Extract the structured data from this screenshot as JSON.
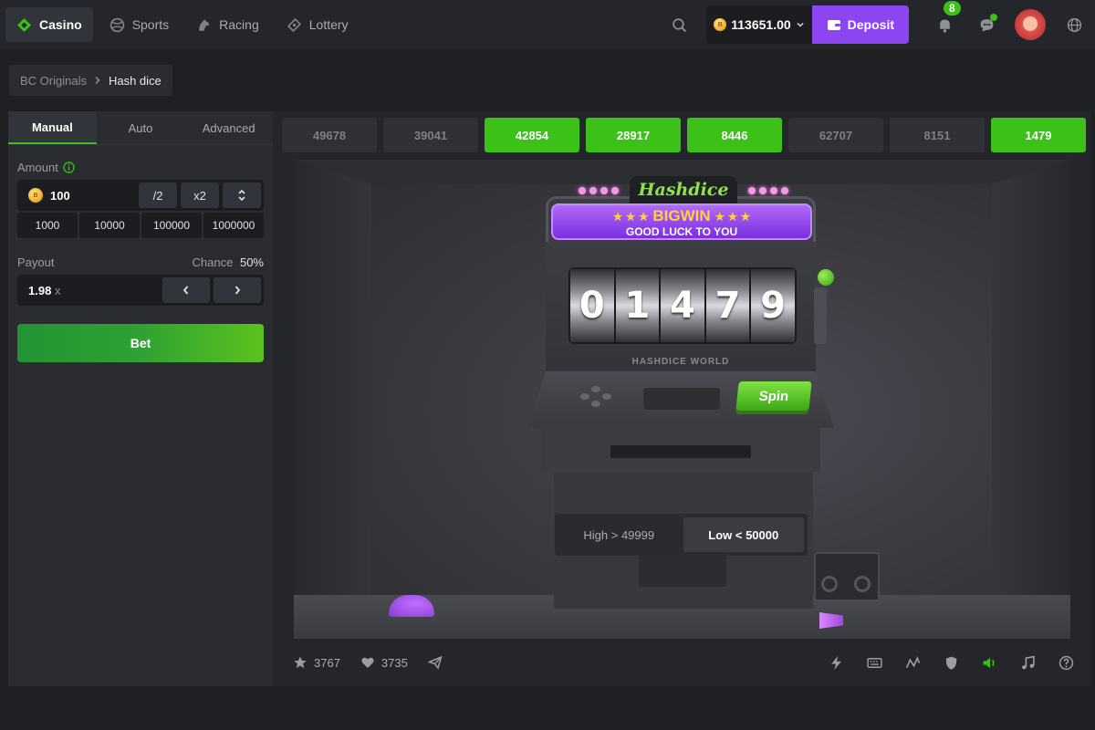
{
  "nav": {
    "items": [
      {
        "label": "Casino",
        "icon": "casino-icon",
        "active": true
      },
      {
        "label": "Sports",
        "icon": "sports-ball-icon",
        "active": false
      },
      {
        "label": "Racing",
        "icon": "horse-icon",
        "active": false
      },
      {
        "label": "Lottery",
        "icon": "lottery-ticket-icon",
        "active": false
      }
    ],
    "balance": "113651.00",
    "deposit_label": "Deposit",
    "notification_count": "8",
    "accent_color": "#3bc117",
    "deposit_color": "#8c45f0"
  },
  "breadcrumb": {
    "parent": "BC Originals",
    "current": "Hash dice"
  },
  "controls": {
    "tabs": [
      {
        "label": "Manual",
        "active": true
      },
      {
        "label": "Auto",
        "active": false
      },
      {
        "label": "Advanced",
        "active": false
      }
    ],
    "amount_label": "Amount",
    "amount_value": "100",
    "half_label": "/2",
    "double_label": "x2",
    "presets": [
      "1000",
      "10000",
      "100000",
      "1000000"
    ],
    "payout_label": "Payout",
    "chance_label": "Chance",
    "chance_value": "50%",
    "payout_value": "1.98",
    "payout_unit": "x",
    "bet_label": "Bet"
  },
  "history": [
    {
      "value": "49678",
      "win": false
    },
    {
      "value": "39041",
      "win": false
    },
    {
      "value": "42854",
      "win": true
    },
    {
      "value": "28917",
      "win": true
    },
    {
      "value": "8446",
      "win": true
    },
    {
      "value": "62707",
      "win": false
    },
    {
      "value": "8151",
      "win": false
    },
    {
      "value": "1479",
      "win": true
    }
  ],
  "machine": {
    "sign": "Hashdice",
    "bigwin_title": "BIGWIN",
    "bigwin_stars": "★ ★ ★",
    "bigwin_subtitle": "GOOD LUCK TO YOU",
    "digits": [
      "0",
      "1",
      "4",
      "7",
      "9"
    ],
    "world_label": "HASHDICE WORLD",
    "spin_label": "Spin",
    "high_label": "High > 49999",
    "low_label": "Low < 50000"
  },
  "footer": {
    "favorites": "3767",
    "likes": "3735",
    "tools": [
      "lightning-icon",
      "keyboard-icon",
      "chart-trend-icon",
      "fairness-shield-icon",
      "sound-icon",
      "music-icon",
      "help-icon"
    ]
  }
}
